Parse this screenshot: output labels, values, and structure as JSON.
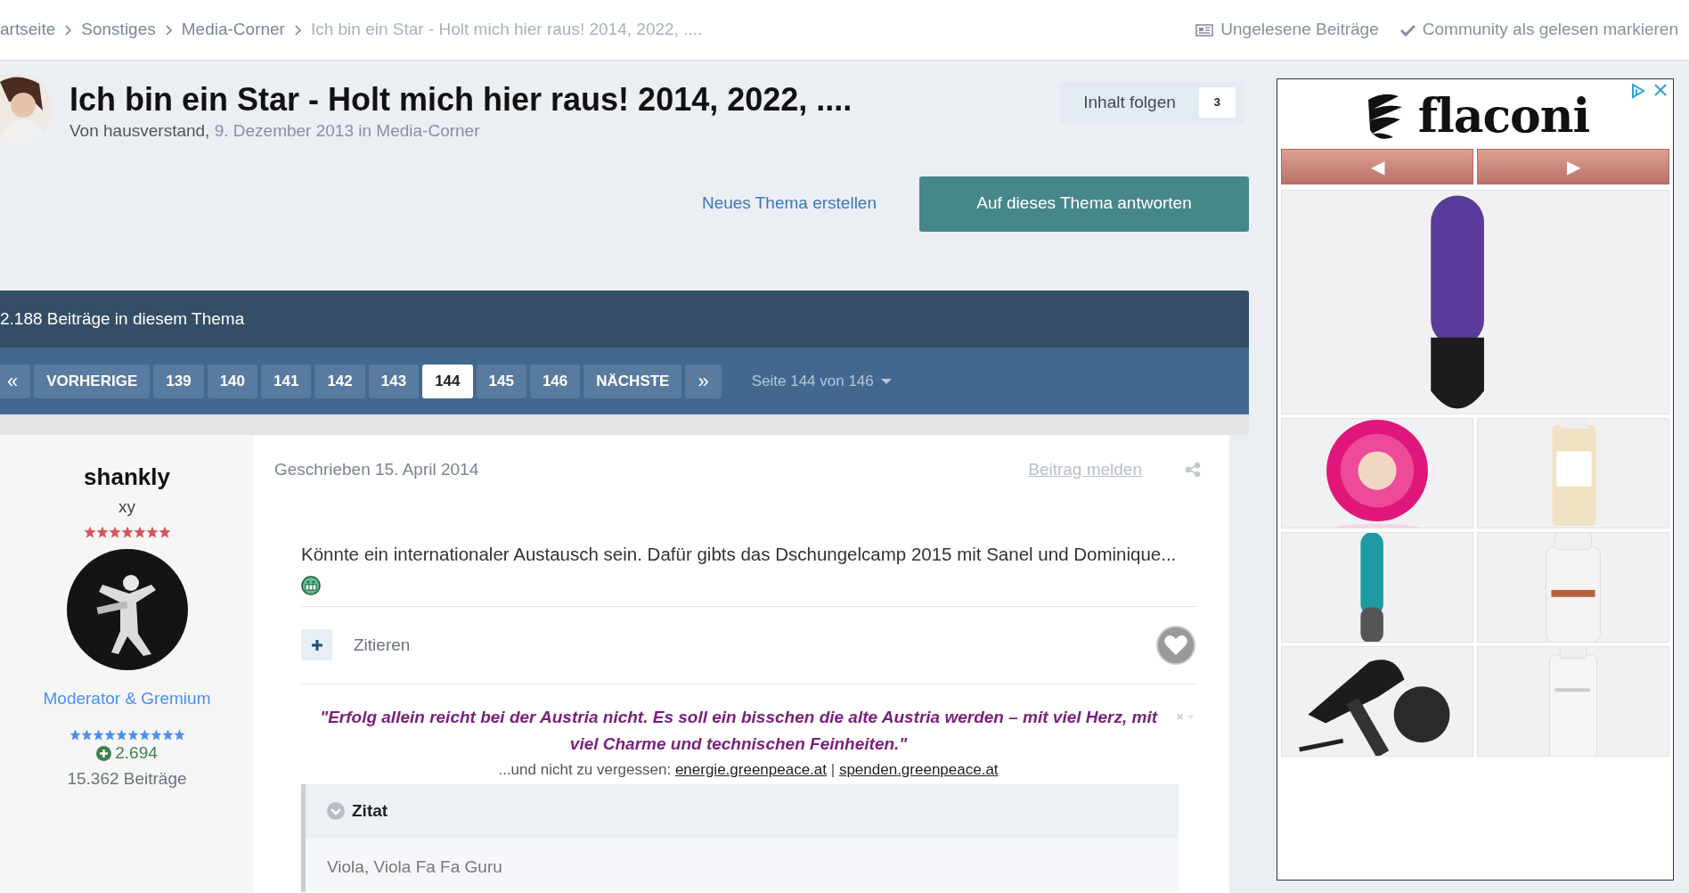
{
  "breadcrumb": [
    {
      "label": "artseite",
      "current": false
    },
    {
      "label": "Sonstiges",
      "current": false
    },
    {
      "label": "Media-Corner",
      "current": false
    },
    {
      "label": "Ich bin ein Star - Holt mich hier raus! 2014, 2022, ....",
      "current": true
    }
  ],
  "top_links": [
    {
      "label": "Ungelesene Beiträge",
      "kind": "newspaper"
    },
    {
      "label": "Community als gelesen markieren",
      "kind": "check"
    }
  ],
  "topic": {
    "title": "Ich bin ein Star - Holt mich hier raus! 2014, 2022, ....",
    "byline": [
      {
        "text": "Von hausverstand,",
        "kind": "author"
      },
      {
        "text": "9. Dezember 2013 in Media-Corner",
        "kind": "meta"
      }
    ],
    "follow": {
      "label": "Inhalt folgen",
      "count": "3"
    },
    "new_topic": "Neues Thema erstellen",
    "reply": "Auf dieses Thema antworten"
  },
  "post_count": "2.188 Beiträge in diesem Thema",
  "pagination": {
    "first": "«",
    "prev": "VORHERIGE",
    "next": "NÄCHSTE",
    "last": "»",
    "info": "Seite 144 von 146",
    "pages": [
      {
        "label": "139",
        "selected": false
      },
      {
        "label": "140",
        "selected": false
      },
      {
        "label": "141",
        "selected": false
      },
      {
        "label": "142",
        "selected": false
      },
      {
        "label": "143",
        "selected": false
      },
      {
        "label": "144",
        "selected": true
      },
      {
        "label": "145",
        "selected": false
      },
      {
        "label": "146",
        "selected": false
      }
    ]
  },
  "post": {
    "author": {
      "name": "shankly",
      "title": "xy",
      "rank": {
        "stars": 7
      },
      "group": "Moderator & Gremium",
      "group_rank": {
        "stars": 10
      },
      "reputation": "2.694",
      "posts": "15.362 Beiträge"
    },
    "date": "Geschrieben 15. April 2014",
    "report": "Beitrag melden",
    "body": "Könnte ein internationaler Austausch sein. Dafür gibts das Dschungelcamp 2015 mit Sanel und Dominique...",
    "quote_action": "Zitieren",
    "signature": {
      "quote": "\"Erfolg allein reicht bei der Austria nicht. Es soll ein bisschen die alte Austria werden – mit viel Herz, mit viel Charme und technischen Feinheiten.\"",
      "note": "...und nicht zu vergessen:",
      "links": [
        "energie.greenpeace.at",
        "spenden.greenpeace.at"
      ],
      "separator": "|",
      "quote_box": {
        "title": "Zitat",
        "text": "Viola, Viola Fa Fa Guru"
      }
    }
  },
  "ad": {
    "logo": "flaconi",
    "prev": "◀",
    "next": "▶"
  }
}
